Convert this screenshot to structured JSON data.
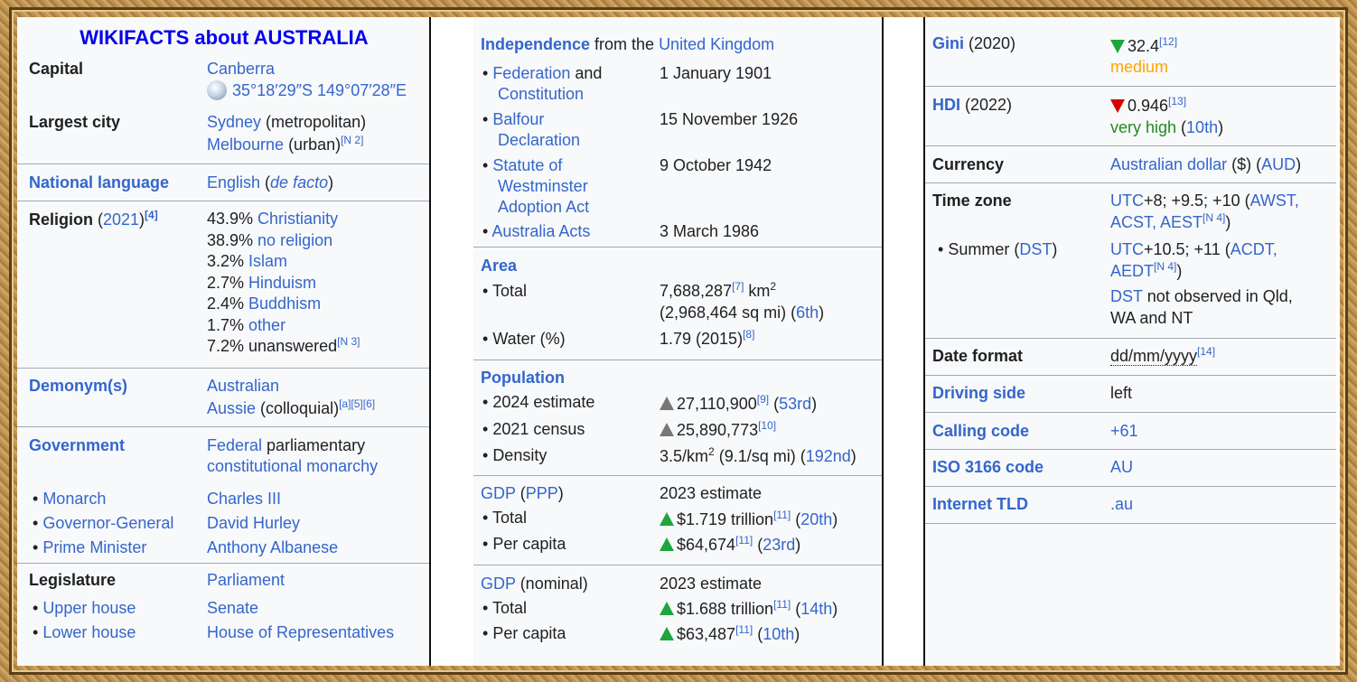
{
  "title": "WIKIFACTS about AUSTRALIA",
  "col1": {
    "capital_label": "Capital",
    "capital_value": "Canberra",
    "capital_coords": "35°18′29″S 149°07′28″E",
    "largest_city_label": "Largest city",
    "largest_city_1": "Sydney",
    "largest_city_1_note": " (metropolitan)",
    "largest_city_2": "Melbourne",
    "largest_city_2_note": " (urban)",
    "largest_city_2_ref": "[N 2]",
    "national_language_label": "National language",
    "national_language_value": "English",
    "national_language_open": " (",
    "national_language_note": "de facto",
    "national_language_close": ")",
    "religion_label": "Religion",
    "religion_year_open": " (",
    "religion_year": "2021",
    "religion_year_close": ")",
    "religion_ref": "[4]",
    "religions": [
      {
        "pct": "43.9% ",
        "name": "Christianity",
        "link": true,
        "ref": ""
      },
      {
        "pct": "38.9% ",
        "name": "no religion",
        "link": true,
        "ref": ""
      },
      {
        "pct": "3.2% ",
        "name": "Islam",
        "link": true,
        "ref": ""
      },
      {
        "pct": "2.7% ",
        "name": "Hinduism",
        "link": true,
        "ref": ""
      },
      {
        "pct": "2.4% ",
        "name": "Buddhism",
        "link": true,
        "ref": ""
      },
      {
        "pct": "1.7% ",
        "name": "other",
        "link": true,
        "ref": ""
      },
      {
        "pct": "7.2% ",
        "name": "unanswered",
        "link": false,
        "ref": "[N 3]"
      }
    ],
    "demonym_label": "Demonym(s)",
    "demonym_1": "Australian",
    "demonym_2": "Aussie",
    "demonym_2_note": " (colloquial)",
    "demonym_2_ref": "[a][5][6]",
    "government_label": "Government",
    "government_value_1a": "Federal",
    "government_value_1b": " parliamentary",
    "government_value_2": "constitutional monarchy",
    "gov_rows": [
      {
        "label": "Monarch",
        "value": "Charles III"
      },
      {
        "label": "Governor-General",
        "value": "David Hurley"
      },
      {
        "label": "Prime Minister",
        "value": "Anthony Albanese"
      }
    ],
    "legislature_label": "Legislature",
    "legislature_value": "Parliament",
    "leg_rows": [
      {
        "label": "Upper house",
        "value": "Senate"
      },
      {
        "label": "Lower house",
        "value": "House of Representatives"
      }
    ]
  },
  "col2": {
    "independence_label": "Independence",
    "independence_from": " from the ",
    "independence_uk": "United Kingdom",
    "independence_rows": [
      {
        "label_1": "Federation",
        "label_1b": " and",
        "label_2": "Constitution",
        "label_3": "",
        "date": "1 January 1901"
      },
      {
        "label_1": "Balfour",
        "label_1b": "",
        "label_2": "Declaration",
        "label_3": "",
        "date": "15 November 1926"
      },
      {
        "label_1": "Statute of",
        "label_1b": "",
        "label_2": "Westminster",
        "label_3": "Adoption Act",
        "date": "9 October 1942"
      },
      {
        "label_1": "Australia Acts",
        "label_1b": "",
        "label_2": "",
        "label_3": "",
        "date": "3 March 1986"
      }
    ],
    "area_label": "Area",
    "area_total_label": "Total",
    "area_total_value": "7,688,287",
    "area_total_ref": "[7]",
    "area_total_unit": " km",
    "area_total_unit_sup": "2",
    "area_total_sqmi": "(2,968,464 sq mi) (",
    "area_total_rank": "6th",
    "area_total_close": ")",
    "water_label": "Water (%)",
    "water_value": "1.79 (2015)",
    "water_ref": "[8]",
    "population_label": "Population",
    "pop_2024_label": "2024 estimate",
    "pop_2024_value": "27,110,900",
    "pop_2024_ref": "[9]",
    "pop_2024_rank_open": " (",
    "pop_2024_rank": "53rd",
    "pop_2024_rank_close": ")",
    "pop_2021_label": "2021 census",
    "pop_2021_value": "25,890,773",
    "pop_2021_ref": "[10]",
    "density_label": "Density",
    "density_value": "3.5/km",
    "density_sup": "2",
    "density_rest": " (9.1/sq mi) (",
    "density_rank": "192nd",
    "density_close": ")",
    "gdp_ppp_label": "GDP",
    "gdp_ppp_open": " (",
    "gdp_ppp_link": "PPP",
    "gdp_ppp_close": ")",
    "gdp_ppp_estimate": "2023 estimate",
    "gdp_ppp_total_label": "Total",
    "gdp_ppp_total_value": "$1.719 trillion",
    "gdp_ppp_total_ref": "[11]",
    "gdp_ppp_total_rank_open": " (",
    "gdp_ppp_total_rank": "20th",
    "gdp_ppp_total_rank_close": ")",
    "gdp_ppp_pc_label": "Per capita",
    "gdp_ppp_pc_value": "$64,674",
    "gdp_ppp_pc_ref": "[11]",
    "gdp_ppp_pc_rank_open": " (",
    "gdp_ppp_pc_rank": "23rd",
    "gdp_ppp_pc_rank_close": ")",
    "gdp_nom_label": "GDP",
    "gdp_nom_note": " (nominal)",
    "gdp_nom_estimate": "2023 estimate",
    "gdp_nom_total_label": "Total",
    "gdp_nom_total_value": "$1.688 trillion",
    "gdp_nom_total_ref": "[11]",
    "gdp_nom_total_rank_open": " (",
    "gdp_nom_total_rank": "14th",
    "gdp_nom_total_rank_close": ")",
    "gdp_nom_pc_label": "Per capita",
    "gdp_nom_pc_value": "$63,487",
    "gdp_nom_pc_ref": "[11]",
    "gdp_nom_pc_rank_open": " (",
    "gdp_nom_pc_rank": "10th",
    "gdp_nom_pc_rank_close": ")"
  },
  "col3": {
    "gini_label": "Gini",
    "gini_year": " (2020)",
    "gini_value": "32.4",
    "gini_ref": "[12]",
    "gini_rating": "medium",
    "hdi_label": "HDI",
    "hdi_year": " (2022)",
    "hdi_value": "0.946",
    "hdi_ref": "[13]",
    "hdi_rating": "very high",
    "hdi_rank_open": " (",
    "hdi_rank": "10th",
    "hdi_rank_close": ")",
    "currency_label": "Currency",
    "currency_value": "Australian dollar",
    "currency_symbol": " ($) (",
    "currency_code": "AUD",
    "currency_close": ")",
    "timezone_label": "Time zone",
    "tz_utc": "UTC",
    "tz_offsets": "+8; +9.5; +10 (",
    "tz_awst": "AWST,",
    "tz_line2": "ACST, AEST",
    "tz_ref": "[N 4]",
    "tz_close": ")",
    "summer_label": "Summer (",
    "summer_dst": "DST",
    "summer_close": ")",
    "summer_utc": "UTC",
    "summer_offsets": "+10.5; +11 (",
    "summer_acdt": "ACDT,",
    "summer_aedt": "AEDT",
    "summer_ref": "[N 4]",
    "summer_end": ")",
    "dst_link": "DST",
    "dst_note_1": " not observed in Qld,",
    "dst_note_2": "WA and NT",
    "date_format_label": "Date format",
    "date_format_value": "dd/mm/yyyy",
    "date_format_ref": "[14]",
    "driving_label": "Driving side",
    "driving_value": "left",
    "calling_label": "Calling code",
    "calling_value": "+61",
    "iso_label": "ISO 3166 code",
    "iso_value": "AU",
    "tld_label": "Internet TLD",
    "tld_value": ".au"
  },
  "colors": {
    "link": "#3366cc",
    "text": "#202122",
    "title": "#0000ee",
    "up": "#1ea63a",
    "down": "#d50000",
    "medium": "#ffa500",
    "very_high": "#228b22"
  }
}
